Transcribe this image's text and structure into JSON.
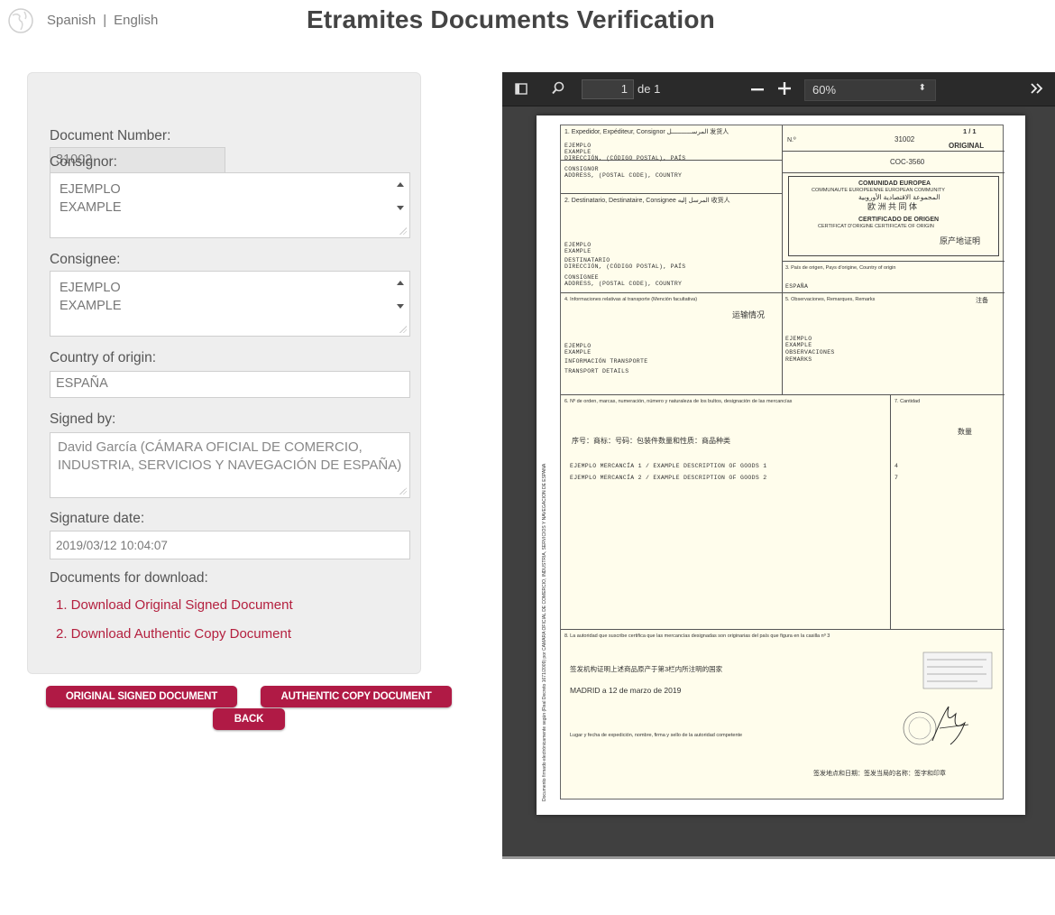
{
  "header": {
    "lang_spanish": "Spanish",
    "lang_separator": "|",
    "lang_english": "English",
    "title": "Etramites Documents Verification"
  },
  "form": {
    "document_number_label": "Document Number:",
    "document_number": "31002",
    "consignor_label": "Consignor:",
    "consignor_lines": [
      "EJEMPLO",
      "EXAMPLE"
    ],
    "consignee_label": "Consignee:",
    "consignee_lines": [
      "EJEMPLO",
      "EXAMPLE"
    ],
    "country_label": "Country of origin:",
    "country": "ESPAÑA",
    "signed_by_label": "Signed by:",
    "signed_by": "David García (CÁMARA OFICIAL DE COMERCIO, INDUSTRIA, SERVICIOS Y NAVEGACIÓN DE ESPAÑA)",
    "signature_date_label": "Signature date:",
    "signature_date": "2019/03/12 10:04:07",
    "downloads_label": "Documents for download:",
    "downloads": [
      "1. Download Original Signed Document",
      "2. Download Authentic Copy Document"
    ]
  },
  "buttons": {
    "original": "ORIGINAL SIGNED DOCUMENT",
    "authentic": "AUTHENTIC COPY DOCUMENT",
    "back": "BACK"
  },
  "viewer": {
    "page_number": "1",
    "page_of": "de 1",
    "zoom": "60%",
    "zoom_arrow": "⬍"
  },
  "certificate": {
    "no_label": "N.º",
    "no_value": "31002",
    "page_count": "1 / 1",
    "original": "ORIGINAL",
    "coc": "COC-3560",
    "box1": "1. Expedidor, Expéditeur, Consignor  المرســـــــــــل  发货人",
    "box1_text": [
      "EJEMPLO",
      "EXAMPLE",
      "DIRECCIÓN, (CÓDIGO POSTAL), PAÍS",
      "CONSIGNOR",
      "ADDRESS, (POSTAL CODE), COUNTRY"
    ],
    "box2": "2. Destinatario, Destinataire, Consignee  المرسل إليه  收货人",
    "box2_text": [
      "EJEMPLO",
      "EXAMPLE",
      "DESTINATARIO",
      "DIRECCIÓN, (CÓDIGO POSTAL), PAÍS",
      "CONSIGNEE",
      "ADDRESS, (POSTAL CODE), COUNTRY"
    ],
    "community": "COMUNIDAD EUROPEA",
    "community_sub": "COMMUNAUTE EUROPEENNE  EUROPEAN COMMUNITY",
    "community_ar": "المجموعة الاقتصادية الأوروبية",
    "community_zh": "欧 洲 共 同 体",
    "cert_origin": "CERTIFICADO DE ORIGEN",
    "cert_origin_sub": "CERTIFICAT D'ORIGINE  CERTIFICATE OF ORIGIN",
    "cert_origin_zh": "原产地证明",
    "box3": "3. País de origen, Pays d'origine, Country of origin",
    "box3_value": "ESPAÑA",
    "box4": "4. Informaciones relativas al transporte (Mención facultativa)",
    "box4_zh": "运输情况",
    "box4_text": [
      "EJEMPLO",
      "EXAMPLE",
      "INFORMACIÓN TRANSPORTE",
      "TRANSPORT DETAILS"
    ],
    "box5": "5. Observaciones, Remarques, Remarks",
    "box5_zh": "注备",
    "box5_text": [
      "EJEMPLO",
      "EXAMPLE",
      "OBSERVACIONES",
      "REMARKS"
    ],
    "box6": "6. Nº de orden, marcas, numeración, número y naturaleza de los bultos, designación de las mercancías",
    "box6_zh": "序号：商标：号码：包装件数量和性质：商品种类",
    "box7": "7. Cantidad",
    "box7_zh": "数量",
    "goods": [
      {
        "desc": "EJEMPLO MERCANCÍA 1 / EXAMPLE DESCRIPTION OF GOODS 1",
        "qty": "4"
      },
      {
        "desc": "EJEMPLO MERCANCÍA 2 / EXAMPLE DESCRIPTION OF GOODS 2",
        "qty": "7"
      }
    ],
    "box8": "8. La autoridad que suscribe certifica que las mercancías designadas son originarias del país que figura en la casilla nº 3",
    "box8_zh": "签发机构证明上述商品原产于第3栏内所注明的国家",
    "place_date": "MADRID a 12 de marzo de 2019",
    "footer_label": "Lugar y fecha de expedición, nombre, firma y sello de la autoridad competente",
    "footer_zh": "签发地点和日期：签发当局的名称：签字和印章",
    "side_text": "Documento firmado electrónicamente según (Real Decreto 1671/2009) por CÁMARA OFICIAL DE COMERCIO, INDUSTRIA, SERVICIOS Y NAVEGACIÓN DE ESPAÑA"
  }
}
